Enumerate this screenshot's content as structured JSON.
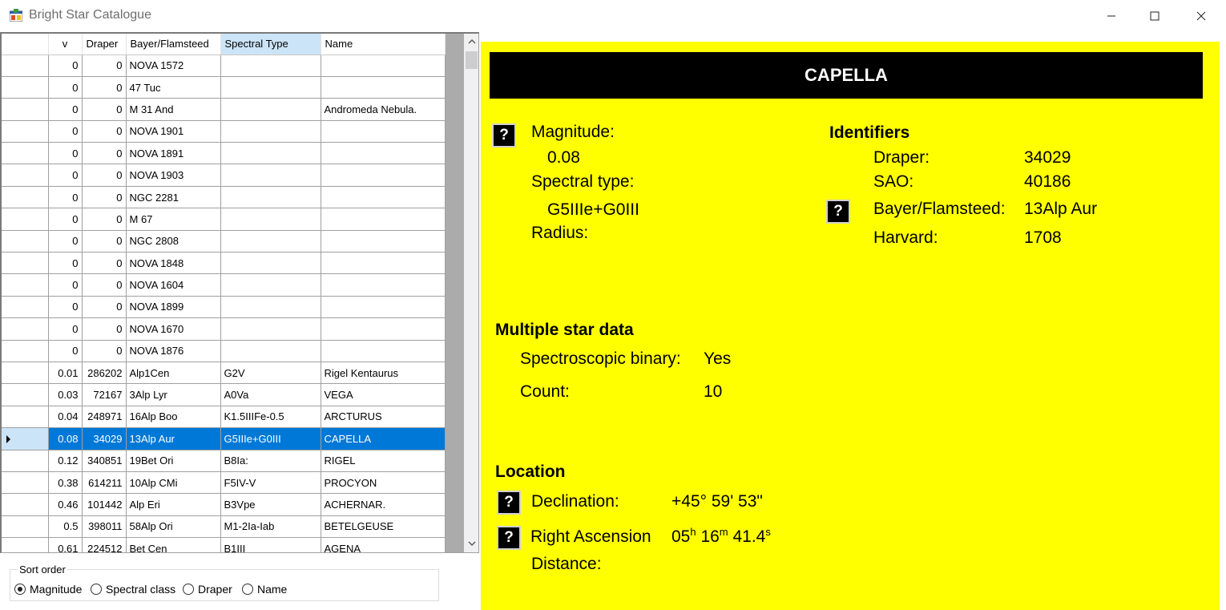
{
  "window": {
    "title": "Bright Star Catalogue"
  },
  "grid": {
    "columns": [
      "v",
      "Draper",
      "Bayer/Flamsteed",
      "Spectral Type",
      "Name"
    ],
    "sorted_column": "Spectral Type",
    "rows": [
      [
        "0",
        "0",
        "NOVA 1572",
        "",
        ""
      ],
      [
        "0",
        "0",
        "47   Tuc",
        "",
        ""
      ],
      [
        "0",
        "0",
        "M 31  And",
        "",
        "Andromeda Nebula."
      ],
      [
        "0",
        "0",
        "NOVA 1901",
        "",
        ""
      ],
      [
        "0",
        "0",
        "NOVA 1891",
        "",
        ""
      ],
      [
        "0",
        "0",
        "NOVA 1903",
        "",
        ""
      ],
      [
        "0",
        "0",
        "NGC 2281",
        "",
        ""
      ],
      [
        "0",
        "0",
        "M 67",
        "",
        ""
      ],
      [
        "0",
        "0",
        "NGC 2808",
        "",
        ""
      ],
      [
        "0",
        "0",
        "NOVA 1848",
        "",
        ""
      ],
      [
        "0",
        "0",
        "NOVA 1604",
        "",
        ""
      ],
      [
        "0",
        "0",
        "NOVA 1899",
        "",
        ""
      ],
      [
        "0",
        "0",
        "NOVA 1670",
        "",
        ""
      ],
      [
        "0",
        "0",
        "NOVA 1876",
        "",
        ""
      ],
      [
        "0.01",
        "286202",
        "Alp1Cen",
        "G2V",
        "Rigel Kentaurus"
      ],
      [
        "0.03",
        "72167",
        "3Alp Lyr",
        "A0Va",
        "VEGA"
      ],
      [
        "0.04",
        "248971",
        "16Alp Boo",
        "K1.5IIIFe-0.5",
        "ARCTURUS"
      ],
      [
        "0.08",
        "34029",
        "13Alp Aur",
        "G5IIIe+G0III",
        "CAPELLA"
      ],
      [
        "0.12",
        "340851",
        "19Bet Ori",
        "B8Ia:",
        "RIGEL"
      ],
      [
        "0.38",
        "614211",
        "10Alp CMi",
        "F5IV-V",
        "PROCYON"
      ],
      [
        "0.46",
        "101442",
        "Alp Eri",
        "B3Vpe",
        "ACHERNAR."
      ],
      [
        "0.5",
        "398011",
        "58Alp Ori",
        "M1-2Ia-Iab",
        "BETELGEUSE"
      ],
      [
        "0.61",
        "224512",
        "Bet Cen",
        "B1III",
        "AGENA"
      ]
    ],
    "selected_index": 17
  },
  "sort": {
    "legend": "Sort order",
    "options": [
      "Magnitude",
      "Spectral class",
      "Draper",
      "Name"
    ],
    "selected": "Magnitude"
  },
  "detail": {
    "star_name": "CAPELLA",
    "help_label": "?",
    "magnitude_label": "Magnitude:",
    "magnitude_value": "0.08",
    "spectral_label": "Spectral type:",
    "spectral_value": "G5IIIe+G0III",
    "radius_label": "Radius:",
    "identifiers_heading": "Identifiers",
    "draper_label": "Draper:",
    "draper_value": "34029",
    "sao_label": "SAO:",
    "sao_value": "40186",
    "bayer_label": "Bayer/Flamsteed:",
    "bayer_value": "13Alp Aur",
    "harvard_label": "Harvard:",
    "harvard_value": "1708",
    "multiple_heading": "Multiple star data",
    "binary_label": "Spectroscopic binary:",
    "binary_value": "Yes",
    "count_label": "Count:",
    "count_value": "10",
    "location_heading": "Location",
    "declination_label": "Declination:",
    "declination_value": "+45° 59' 53\"",
    "ra_label": "Right Ascension",
    "ra_h": "05",
    "ra_h_unit": "h",
    "ra_m": "16",
    "ra_m_unit": "m",
    "ra_s": "41.4",
    "ra_s_unit": "s",
    "distance_label": "Distance:"
  },
  "colors": {
    "panel": "#ffff00",
    "selection": "#0078d7",
    "title_bar": "#000000"
  }
}
